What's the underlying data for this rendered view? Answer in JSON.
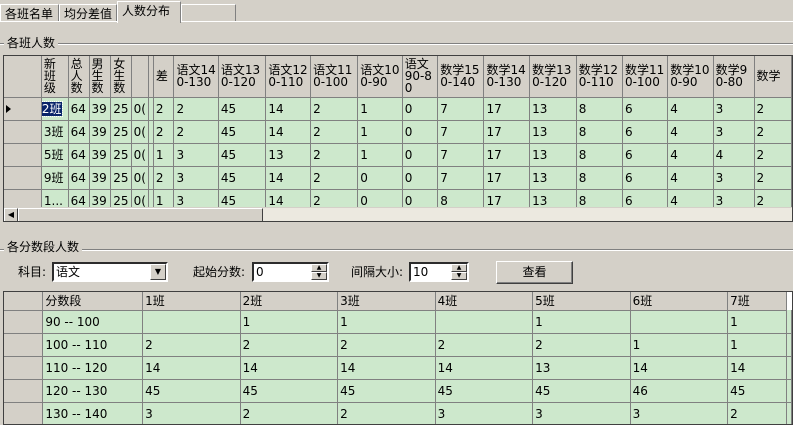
{
  "tabs": [
    {
      "label": "各班名单"
    },
    {
      "label": "均分差值"
    },
    {
      "label": "人数分布"
    }
  ],
  "section1": {
    "title": "各班人数",
    "headers": [
      "新班级",
      "总人数",
      "男生数",
      "女生数",
      "",
      "",
      "差",
      "语文140-130",
      "语文130-120",
      "语文120-110",
      "语文110-100",
      "语文100-90",
      "语文90-80",
      "数学150-140",
      "数学140-130",
      "数学130-120",
      "数学120-110",
      "数学110-100",
      "数学100-90",
      "数学90-80",
      "数学"
    ],
    "rows": [
      [
        "2班",
        "64",
        "39",
        "25",
        "0(",
        "",
        "2",
        "2",
        "45",
        "14",
        "2",
        "1",
        "0",
        "7",
        "17",
        "13",
        "8",
        "6",
        "4",
        "3",
        "2"
      ],
      [
        "3班",
        "64",
        "39",
        "25",
        "0(",
        "",
        "2",
        "2",
        "45",
        "14",
        "2",
        "1",
        "0",
        "7",
        "17",
        "13",
        "8",
        "6",
        "4",
        "3",
        "2"
      ],
      [
        "5班",
        "64",
        "39",
        "25",
        "0(",
        "",
        "1",
        "3",
        "45",
        "13",
        "2",
        "1",
        "0",
        "7",
        "17",
        "13",
        "8",
        "6",
        "4",
        "4",
        "2"
      ],
      [
        "9班",
        "64",
        "39",
        "25",
        "0(",
        "",
        "2",
        "3",
        "45",
        "14",
        "2",
        "0",
        "0",
        "7",
        "17",
        "13",
        "8",
        "6",
        "4",
        "3",
        "2"
      ],
      [
        "1...",
        "64",
        "39",
        "25",
        "0(",
        "",
        "1",
        "3",
        "45",
        "14",
        "2",
        "0",
        "0",
        "8",
        "17",
        "13",
        "8",
        "6",
        "4",
        "3",
        "2"
      ],
      [
        "",
        "",
        "",
        "",
        "",
        "",
        "",
        "",
        "",
        "",
        "",
        "",
        "",
        "",
        "",
        "",
        "",
        "",
        "",
        "",
        ""
      ]
    ]
  },
  "section2": {
    "title": "各分数段人数",
    "subject_label": "科目:",
    "subject_value": "语文",
    "start_label": "起始分数:",
    "start_value": "0",
    "interval_label": "间隔大小:",
    "interval_value": "10",
    "view_button": "查看",
    "headers": [
      "分数段",
      "1班",
      "2班",
      "3班",
      "4班",
      "5班",
      "6班",
      "7班"
    ],
    "rows": [
      [
        "90 -- 100",
        "",
        "1",
        "1",
        "",
        "1",
        "",
        "1"
      ],
      [
        "100 -- 110",
        "2",
        "2",
        "2",
        "2",
        "2",
        "1",
        "1"
      ],
      [
        "110 -- 120",
        "14",
        "14",
        "14",
        "14",
        "13",
        "14",
        "14"
      ],
      [
        "120 -- 130",
        "45",
        "45",
        "45",
        "45",
        "45",
        "46",
        "45"
      ],
      [
        "130 -- 140",
        "3",
        "2",
        "2",
        "3",
        "3",
        "3",
        "2"
      ]
    ]
  }
}
